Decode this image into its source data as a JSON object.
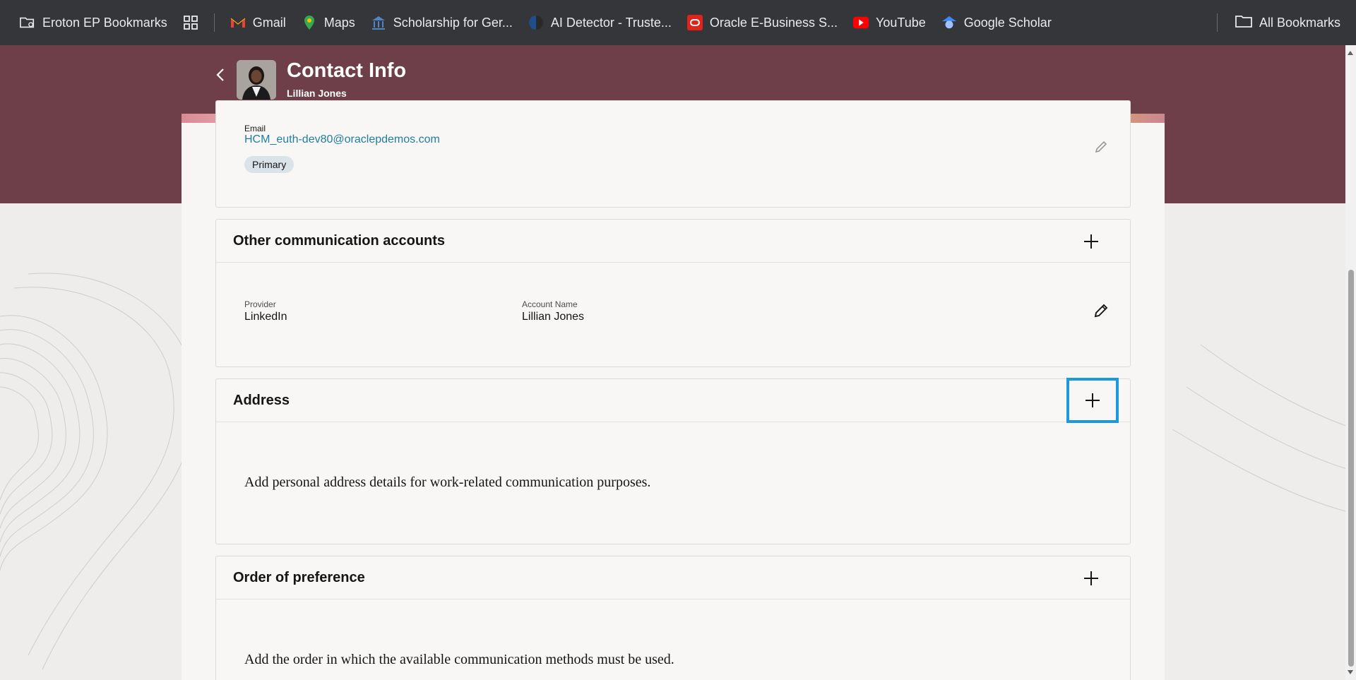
{
  "bookmarks": {
    "items": [
      {
        "label": "Eroton EP Bookmarks",
        "icon": "folder-settings-icon"
      },
      {
        "label": "Gmail",
        "icon": "gmail-icon"
      },
      {
        "label": "Maps",
        "icon": "maps-icon"
      },
      {
        "label": "Scholarship for Ger...",
        "icon": "scholarship-icon"
      },
      {
        "label": "AI Detector - Truste...",
        "icon": "ai-detector-icon"
      },
      {
        "label": "Oracle E-Business S...",
        "icon": "oracle-icon"
      },
      {
        "label": "YouTube",
        "icon": "youtube-icon"
      },
      {
        "label": "Google Scholar",
        "icon": "google-scholar-icon"
      }
    ],
    "all_bookmarks": "All Bookmarks"
  },
  "header": {
    "title": "Contact Info",
    "person": "Lillian Jones"
  },
  "email_card": {
    "label": "Email",
    "value": "HCM_euth-dev80@oraclepdemos.com",
    "badge": "Primary"
  },
  "other_accounts": {
    "title": "Other communication accounts",
    "provider_label": "Provider",
    "provider_value": "LinkedIn",
    "account_label": "Account Name",
    "account_value": "Lillian Jones"
  },
  "address": {
    "title": "Address",
    "empty_text": "Add personal address details for work-related communication purposes."
  },
  "order": {
    "title": "Order of preference",
    "empty_text": "Add the order in which the available communication methods must be used."
  },
  "colors": {
    "header_bg": "#6f3f49",
    "link": "#227e9e",
    "focus_ring": "#1a98e0"
  }
}
